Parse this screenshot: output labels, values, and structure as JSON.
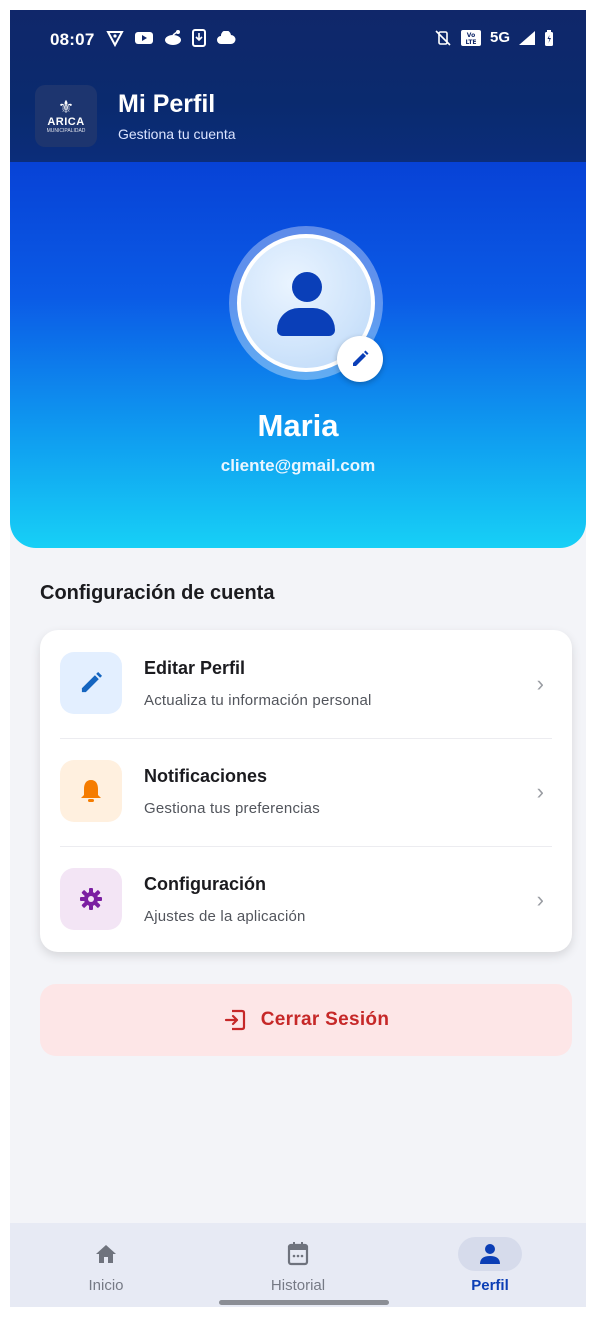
{
  "status_bar": {
    "time": "08:07",
    "network": "5G",
    "left_icons": [
      "vpn-key-icon",
      "youtube-icon",
      "reddit-icon",
      "download-icon",
      "cloud-icon"
    ],
    "right_icons": [
      "mute-vibrate-icon",
      "volte-icon",
      "signal-icon",
      "battery-icon"
    ]
  },
  "header": {
    "logo_text": "ARICA",
    "logo_subtext": "MUNICIPALIDAD",
    "title": "Mi Perfil",
    "subtitle": "Gestiona tu cuenta"
  },
  "profile": {
    "name": "Maria",
    "email": "cliente@gmail.com"
  },
  "section": {
    "title": "Configuración de cuenta"
  },
  "settings_items": [
    {
      "title": "Editar Perfil",
      "subtitle": "Actualiza tu información personal",
      "icon": "pencil-icon",
      "icon_color": "#1565c0",
      "bg": "#e3efff"
    },
    {
      "title": "Notificaciones",
      "subtitle": "Gestiona tus preferencias",
      "icon": "bell-icon",
      "icon_color": "#f57c00",
      "bg": "#fff0df"
    },
    {
      "title": "Configuración",
      "subtitle": "Ajustes de la aplicación",
      "icon": "gear-icon",
      "icon_color": "#7b1fa2",
      "bg": "#f3e5f5"
    }
  ],
  "logout": {
    "label": "Cerrar Sesión",
    "color": "#c62828"
  },
  "bottom_nav": [
    {
      "label": "Inicio",
      "icon": "home-icon",
      "active": false
    },
    {
      "label": "Historial",
      "icon": "calendar-icon",
      "active": false
    },
    {
      "label": "Perfil",
      "icon": "person-icon",
      "active": true
    }
  ],
  "colors": {
    "brand_dark": "#10276a",
    "accent": "#0b3eb5",
    "hero_top": "#0742d6",
    "hero_bottom": "#17d0f6"
  }
}
